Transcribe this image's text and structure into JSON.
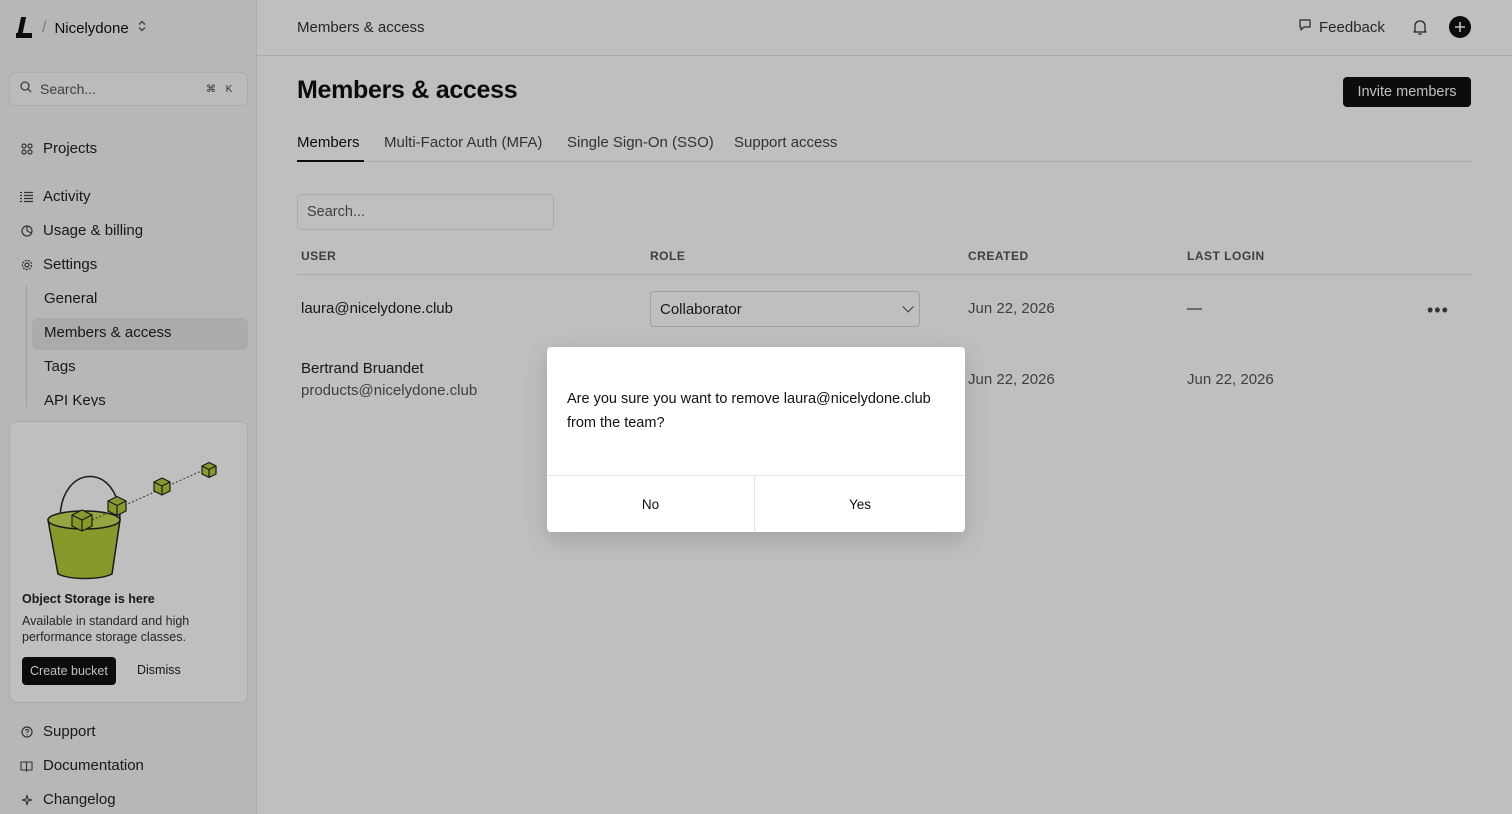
{
  "sidebar": {
    "org_name": "Nicelydone",
    "search_placeholder": "Search...",
    "shortcut_mod": "⌘",
    "shortcut_key": "K",
    "nav": {
      "projects": "Projects",
      "activity": "Activity",
      "billing": "Usage & billing",
      "settings": "Settings"
    },
    "settings_items": [
      "General",
      "Members & access",
      "Tags",
      "API Keys"
    ],
    "promo": {
      "title": "Object Storage is here",
      "desc": "Available in standard and high performance storage classes.",
      "create": "Create bucket",
      "dismiss": "Dismiss"
    },
    "footer": {
      "support": "Support",
      "docs": "Documentation",
      "changelog": "Changelog"
    }
  },
  "topbar": {
    "breadcrumb": "Members & access",
    "feedback": "Feedback"
  },
  "main": {
    "title": "Members & access",
    "invite": "Invite members",
    "tabs": [
      "Members",
      "Multi-Factor Auth (MFA)",
      "Single Sign-On (SSO)",
      "Support access"
    ],
    "search_placeholder": "Search...",
    "columns": [
      "USER",
      "ROLE",
      "CREATED",
      "LAST LOGIN"
    ],
    "rows": [
      {
        "email": "laura@nicelydone.club",
        "role": "Collaborator",
        "created": "Jun 22, 2026",
        "last_login": "—"
      },
      {
        "name": "Bertrand Bruandet",
        "email": "products@nicelydone.club",
        "created": "Jun 22, 2026",
        "last_login": "Jun 22, 2026"
      }
    ]
  },
  "modal": {
    "message": "Are you sure you want to remove laura@nicelydone.club from the team?",
    "no": "No",
    "yes": "Yes"
  },
  "colors": {
    "accent": "#111111",
    "promo_green": "#b5cc3a"
  }
}
